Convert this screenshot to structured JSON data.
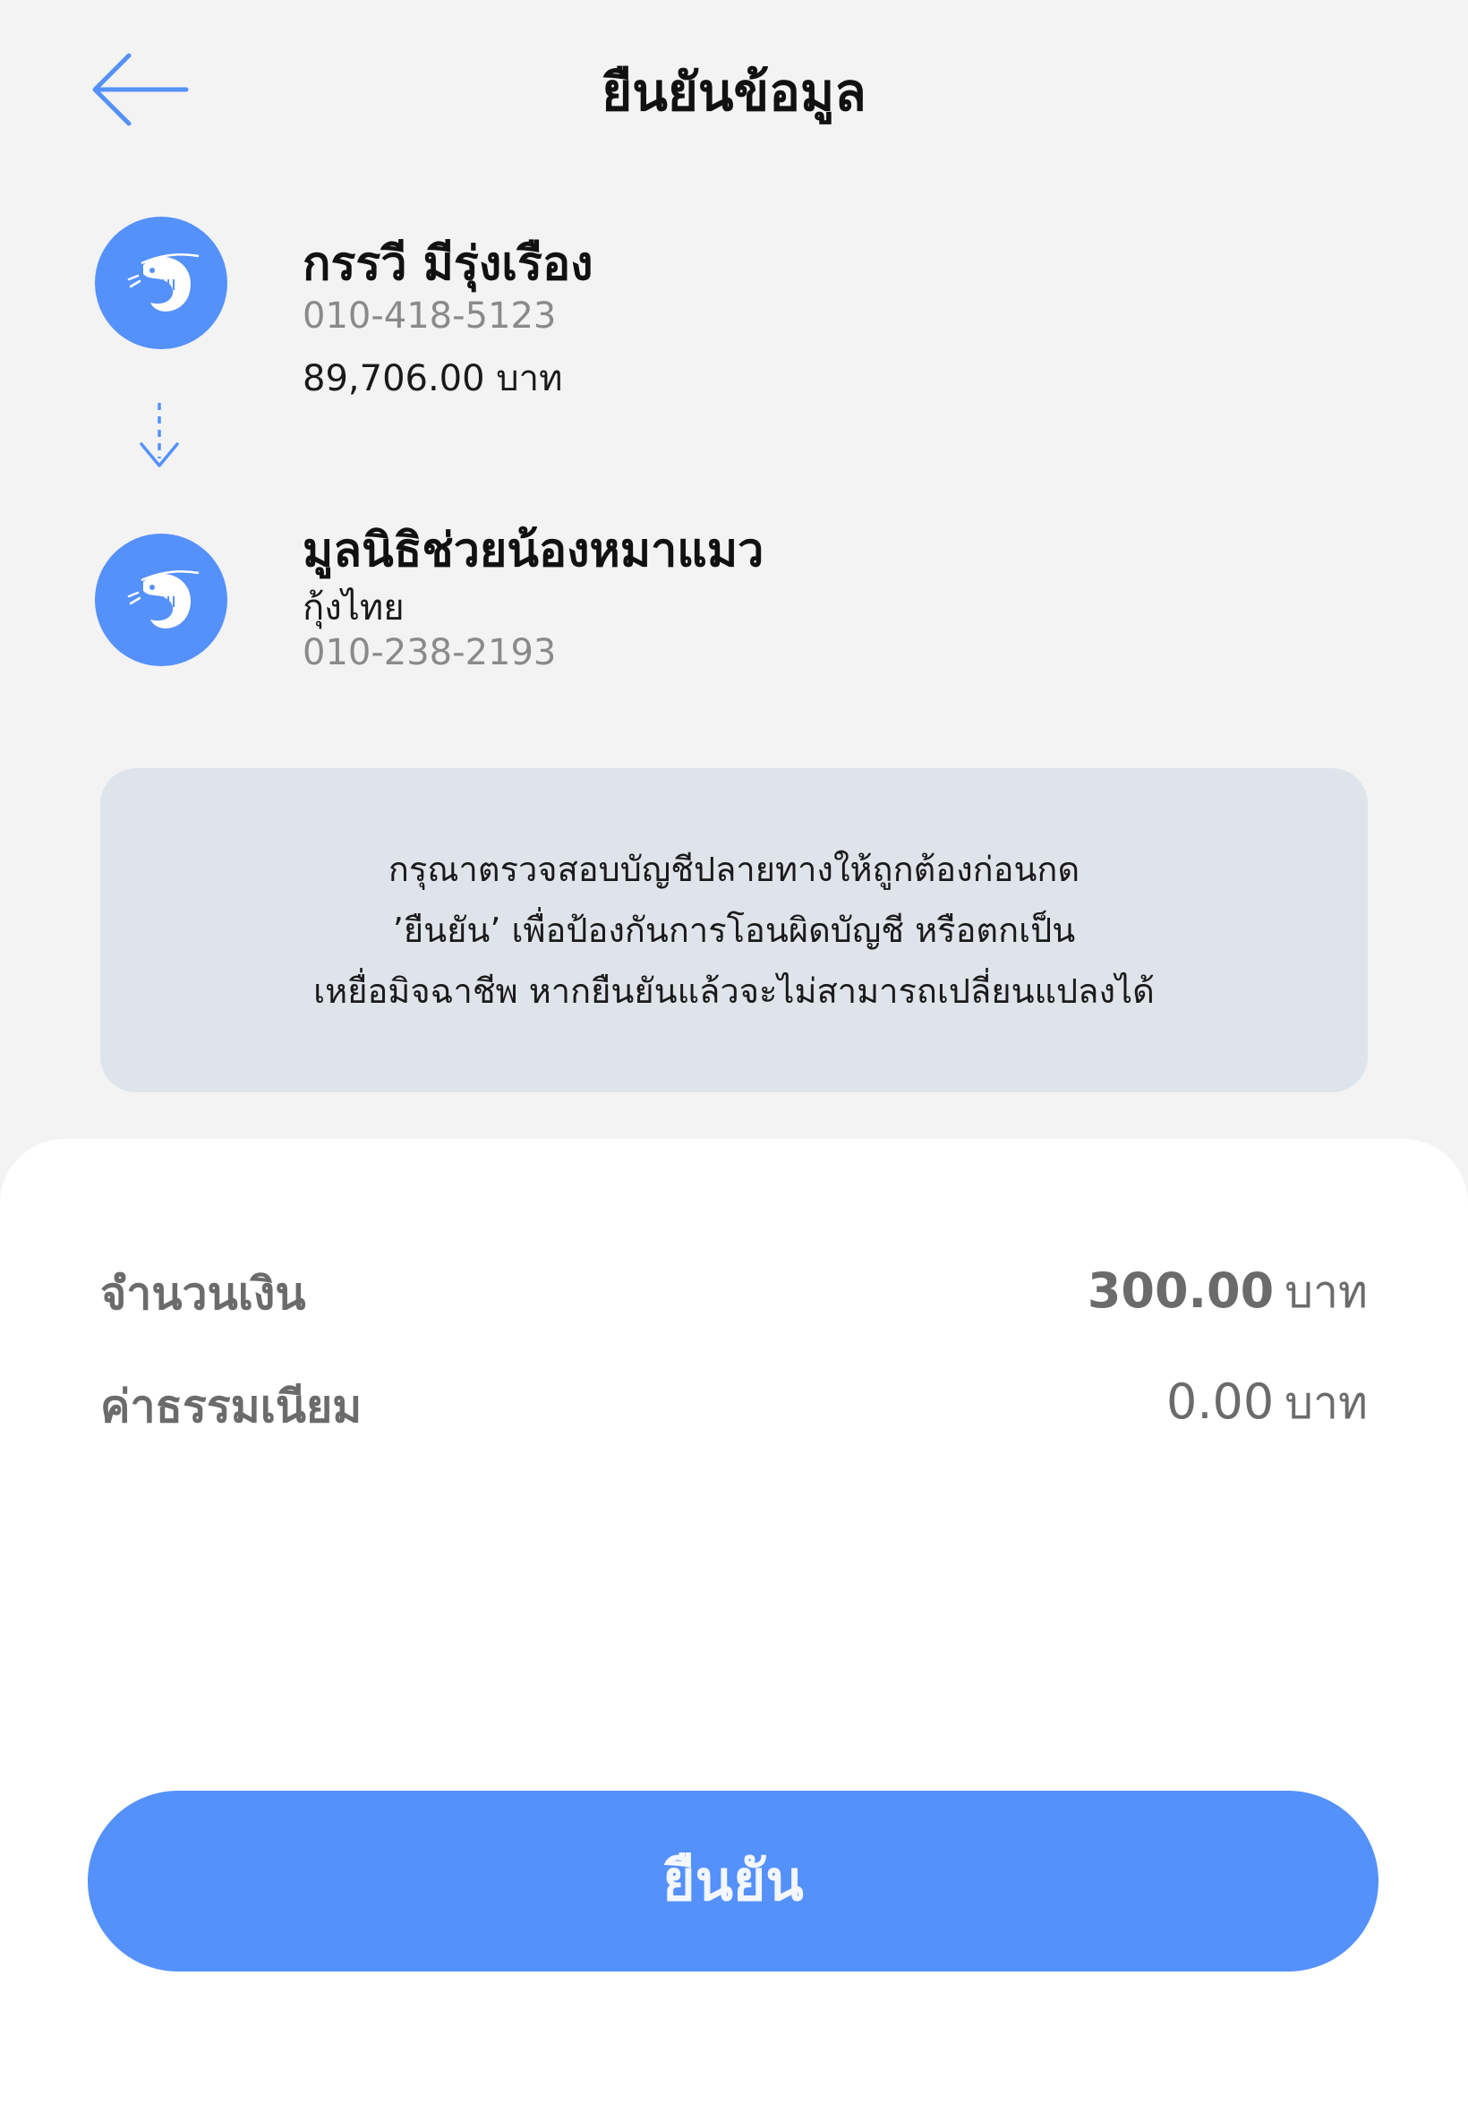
{
  "header": {
    "title": "ยืนยันข้อมูล",
    "back_icon": "arrow-left-icon"
  },
  "sender": {
    "name": "กรรวี มีรุ่งเรือง",
    "account": "010-418-5123",
    "balance": "89,706.00 บาท",
    "avatar_icon": "shrimp-logo-icon"
  },
  "transfer_icon": "dashed-arrow-down-icon",
  "recipient": {
    "name": "มูลนิธิช่วยน้องหมาแมว",
    "bank": "กุ้งไทย",
    "account": "010-238-2193",
    "avatar_icon": "shrimp-logo-icon"
  },
  "warning": {
    "lines": [
      "กรุณาตรวจสอบบัญชีปลายทางให้ถูกต้องก่อนกด",
      "’ยืนยัน’ เพื่อป้องกันการโอนผิดบัญชี หรือตกเป็น",
      "เหยื่อมิจฉาชีพ หากยืนยันแล้วจะไม่สามารถเปลี่ยนแปลงได้"
    ]
  },
  "summary": {
    "amount_label": "จำนวนเงิน",
    "amount_value": "300.00",
    "fee_label": "ค่าธรรมเนียม",
    "fee_value": "0.00",
    "currency": "บาท"
  },
  "confirm_button": {
    "label": "ยืนยัน"
  },
  "colors": {
    "accent": "#5591fb",
    "background": "#f3f3f3",
    "warning_bg": "#dee4ea",
    "sheet_bg": "#ffffff"
  }
}
